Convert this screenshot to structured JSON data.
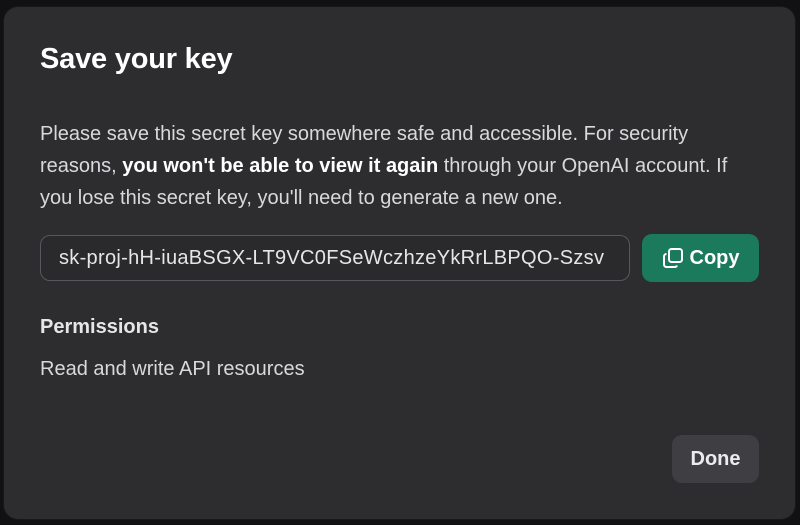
{
  "dialog": {
    "title": "Save your key",
    "description": {
      "part1": "Please save this secret key somewhere safe and accessible. For security reasons, ",
      "emphasis": "you won't be able to view it again",
      "part2": " through your OpenAI account. If you lose this secret key, you'll need to generate a new one."
    },
    "key_value": "sk-proj-hH-iuaBSGX-LT9VC0FSeWczhzeYkRrLBPQO-Szsv",
    "copy_button": {
      "label": "Copy",
      "icon": "copy-icon",
      "color": "#1c7a5c"
    },
    "permissions": {
      "label": "Permissions",
      "value": "Read and write API resources"
    },
    "done_button": {
      "label": "Done"
    }
  }
}
